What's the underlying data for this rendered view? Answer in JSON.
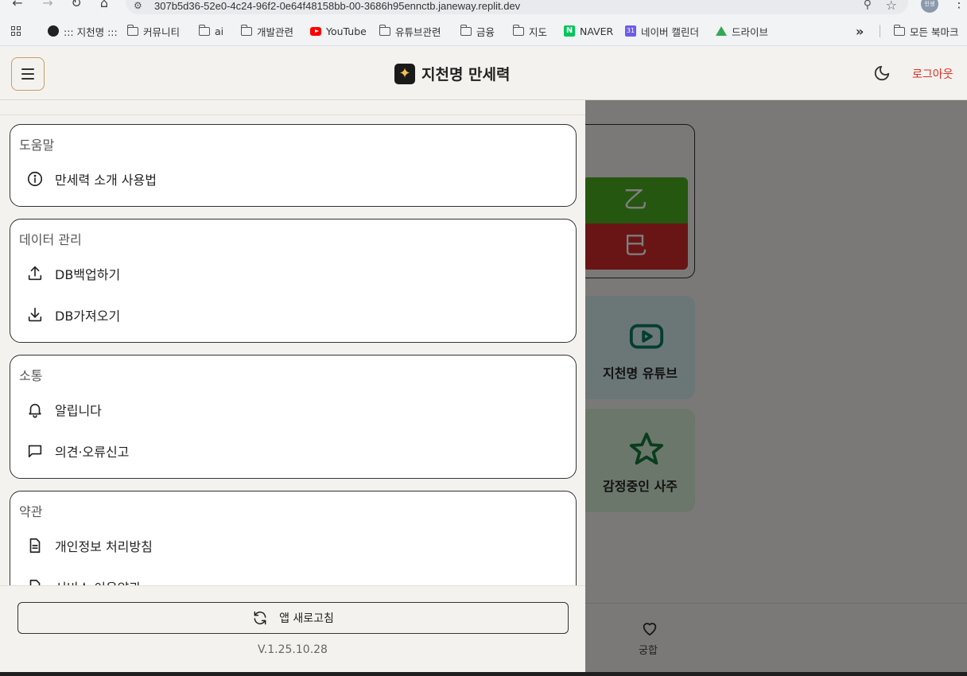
{
  "browser": {
    "url": "307b5d36-52e0-4c24-96f2-0e64f48158bb-00-3686h95ennctb.janeway.replit.dev",
    "profile_label": "인생",
    "bookmarks": [
      {
        "label": "::: 지천명 :::",
        "icon": "globe-icon"
      },
      {
        "label": "커뮤니티",
        "icon": "folder-icon"
      },
      {
        "label": "ai",
        "icon": "folder-icon"
      },
      {
        "label": "개발관련",
        "icon": "folder-icon"
      },
      {
        "label": "YouTube",
        "icon": "youtube-icon"
      },
      {
        "label": "유튜브관련",
        "icon": "folder-icon"
      },
      {
        "label": "금융",
        "icon": "folder-icon"
      },
      {
        "label": "지도",
        "icon": "folder-icon"
      },
      {
        "label": "NAVER",
        "icon": "naver-icon"
      },
      {
        "label": "네이버 캘린더",
        "icon": "calendar-icon"
      },
      {
        "label": "드라이브",
        "icon": "drive-icon"
      }
    ],
    "overflow": "»",
    "all_bookmarks": "모든 북마크"
  },
  "header": {
    "title": "지천명 만세력",
    "logout": "로그아웃"
  },
  "background": {
    "pillar_top": "乙",
    "pillar_bottom": "巳",
    "youtube_label": "지천명 유튜브",
    "favorite_label": "감정중인 사주",
    "nav_label": "궁합",
    "colors": {
      "stem": "#4caf20",
      "branch": "#d32a2a"
    }
  },
  "drawer": {
    "sections": [
      {
        "title": "도움말",
        "items": [
          {
            "label": "만세력 소개 사용법",
            "icon": "info-icon"
          }
        ]
      },
      {
        "title": "데이터 관리",
        "items": [
          {
            "label": "DB백업하기",
            "icon": "upload-icon"
          },
          {
            "label": "DB가져오기",
            "icon": "download-icon"
          }
        ]
      },
      {
        "title": "소통",
        "items": [
          {
            "label": "알립니다",
            "icon": "bell-icon"
          },
          {
            "label": "의견·오류신고",
            "icon": "message-icon"
          }
        ]
      },
      {
        "title": "약관",
        "items": [
          {
            "label": "개인정보 처리방침",
            "icon": "document-icon"
          },
          {
            "label": "서비스 이용약관",
            "icon": "document-icon"
          }
        ]
      }
    ],
    "refresh_label": "앱 새로고침",
    "version": "V.1.25.10.28"
  }
}
